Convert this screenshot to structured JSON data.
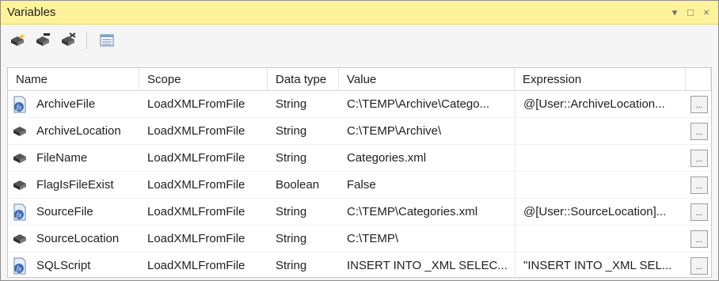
{
  "window": {
    "title": "Variables",
    "controls": {
      "pin": "▾",
      "restore": "□",
      "close": "×"
    }
  },
  "toolbar": {
    "buttons": [
      {
        "name": "add-variable",
        "icon": "add-variable-icon"
      },
      {
        "name": "move-variable",
        "icon": "move-variable-icon"
      },
      {
        "name": "delete-variable",
        "icon": "delete-variable-icon"
      },
      {
        "name": "grid-options",
        "icon": "grid-options-icon"
      }
    ]
  },
  "grid": {
    "columns": [
      "Name",
      "Scope",
      "Data type",
      "Value",
      "Expression"
    ],
    "rows": [
      {
        "icon": "expression-variable-icon",
        "name": "ArchiveFile",
        "scope": "LoadXMLFromFile",
        "type": "String",
        "value": "C:\\TEMP\\Archive\\Catego...",
        "expression": "@[User::ArchiveLocation..."
      },
      {
        "icon": "variable-icon",
        "name": "ArchiveLocation",
        "scope": "LoadXMLFromFile",
        "type": "String",
        "value": "C:\\TEMP\\Archive\\",
        "expression": ""
      },
      {
        "icon": "variable-icon",
        "name": "FileName",
        "scope": "LoadXMLFromFile",
        "type": "String",
        "value": "Categories.xml",
        "expression": ""
      },
      {
        "icon": "variable-icon",
        "name": "FlagIsFileExist",
        "scope": "LoadXMLFromFile",
        "type": "Boolean",
        "value": "False",
        "expression": ""
      },
      {
        "icon": "expression-variable-icon",
        "name": "SourceFile",
        "scope": "LoadXMLFromFile",
        "type": "String",
        "value": "C:\\TEMP\\Categories.xml",
        "expression": "@[User::SourceLocation]..."
      },
      {
        "icon": "variable-icon",
        "name": "SourceLocation",
        "scope": "LoadXMLFromFile",
        "type": "String",
        "value": "C:\\TEMP\\",
        "expression": ""
      },
      {
        "icon": "expression-variable-icon",
        "name": "SQLScript",
        "scope": "LoadXMLFromFile",
        "type": "String",
        "value": "INSERT INTO _XML SELEC...",
        "expression": "\"INSERT INTO _XML SEL..."
      }
    ],
    "ellipsis_label": "..."
  },
  "colors": {
    "titlebar": "#fff29d",
    "panel": "#f5f5f5",
    "grid_bg": "#ffffff"
  }
}
